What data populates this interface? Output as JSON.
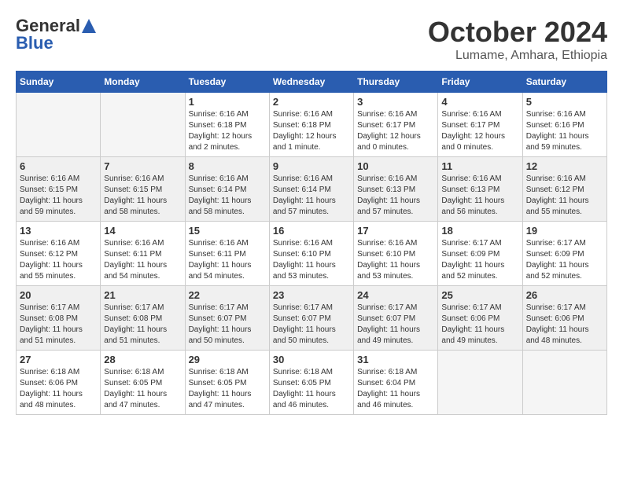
{
  "header": {
    "logo_line1": "General",
    "logo_line2": "Blue",
    "month_title": "October 2024",
    "location": "Lumame, Amhara, Ethiopia"
  },
  "weekdays": [
    "Sunday",
    "Monday",
    "Tuesday",
    "Wednesday",
    "Thursday",
    "Friday",
    "Saturday"
  ],
  "weeks": [
    [
      {
        "day": "",
        "sunrise": "",
        "sunset": "",
        "daylight": "",
        "empty": true
      },
      {
        "day": "",
        "sunrise": "",
        "sunset": "",
        "daylight": "",
        "empty": true
      },
      {
        "day": "1",
        "sunrise": "Sunrise: 6:16 AM",
        "sunset": "Sunset: 6:18 PM",
        "daylight": "Daylight: 12 hours and 2 minutes.",
        "empty": false
      },
      {
        "day": "2",
        "sunrise": "Sunrise: 6:16 AM",
        "sunset": "Sunset: 6:18 PM",
        "daylight": "Daylight: 12 hours and 1 minute.",
        "empty": false
      },
      {
        "day": "3",
        "sunrise": "Sunrise: 6:16 AM",
        "sunset": "Sunset: 6:17 PM",
        "daylight": "Daylight: 12 hours and 0 minutes.",
        "empty": false
      },
      {
        "day": "4",
        "sunrise": "Sunrise: 6:16 AM",
        "sunset": "Sunset: 6:17 PM",
        "daylight": "Daylight: 12 hours and 0 minutes.",
        "empty": false
      },
      {
        "day": "5",
        "sunrise": "Sunrise: 6:16 AM",
        "sunset": "Sunset: 6:16 PM",
        "daylight": "Daylight: 11 hours and 59 minutes.",
        "empty": false
      }
    ],
    [
      {
        "day": "6",
        "sunrise": "Sunrise: 6:16 AM",
        "sunset": "Sunset: 6:15 PM",
        "daylight": "Daylight: 11 hours and 59 minutes.",
        "empty": false
      },
      {
        "day": "7",
        "sunrise": "Sunrise: 6:16 AM",
        "sunset": "Sunset: 6:15 PM",
        "daylight": "Daylight: 11 hours and 58 minutes.",
        "empty": false
      },
      {
        "day": "8",
        "sunrise": "Sunrise: 6:16 AM",
        "sunset": "Sunset: 6:14 PM",
        "daylight": "Daylight: 11 hours and 58 minutes.",
        "empty": false
      },
      {
        "day": "9",
        "sunrise": "Sunrise: 6:16 AM",
        "sunset": "Sunset: 6:14 PM",
        "daylight": "Daylight: 11 hours and 57 minutes.",
        "empty": false
      },
      {
        "day": "10",
        "sunrise": "Sunrise: 6:16 AM",
        "sunset": "Sunset: 6:13 PM",
        "daylight": "Daylight: 11 hours and 57 minutes.",
        "empty": false
      },
      {
        "day": "11",
        "sunrise": "Sunrise: 6:16 AM",
        "sunset": "Sunset: 6:13 PM",
        "daylight": "Daylight: 11 hours and 56 minutes.",
        "empty": false
      },
      {
        "day": "12",
        "sunrise": "Sunrise: 6:16 AM",
        "sunset": "Sunset: 6:12 PM",
        "daylight": "Daylight: 11 hours and 55 minutes.",
        "empty": false
      }
    ],
    [
      {
        "day": "13",
        "sunrise": "Sunrise: 6:16 AM",
        "sunset": "Sunset: 6:12 PM",
        "daylight": "Daylight: 11 hours and 55 minutes.",
        "empty": false
      },
      {
        "day": "14",
        "sunrise": "Sunrise: 6:16 AM",
        "sunset": "Sunset: 6:11 PM",
        "daylight": "Daylight: 11 hours and 54 minutes.",
        "empty": false
      },
      {
        "day": "15",
        "sunrise": "Sunrise: 6:16 AM",
        "sunset": "Sunset: 6:11 PM",
        "daylight": "Daylight: 11 hours and 54 minutes.",
        "empty": false
      },
      {
        "day": "16",
        "sunrise": "Sunrise: 6:16 AM",
        "sunset": "Sunset: 6:10 PM",
        "daylight": "Daylight: 11 hours and 53 minutes.",
        "empty": false
      },
      {
        "day": "17",
        "sunrise": "Sunrise: 6:16 AM",
        "sunset": "Sunset: 6:10 PM",
        "daylight": "Daylight: 11 hours and 53 minutes.",
        "empty": false
      },
      {
        "day": "18",
        "sunrise": "Sunrise: 6:17 AM",
        "sunset": "Sunset: 6:09 PM",
        "daylight": "Daylight: 11 hours and 52 minutes.",
        "empty": false
      },
      {
        "day": "19",
        "sunrise": "Sunrise: 6:17 AM",
        "sunset": "Sunset: 6:09 PM",
        "daylight": "Daylight: 11 hours and 52 minutes.",
        "empty": false
      }
    ],
    [
      {
        "day": "20",
        "sunrise": "Sunrise: 6:17 AM",
        "sunset": "Sunset: 6:08 PM",
        "daylight": "Daylight: 11 hours and 51 minutes.",
        "empty": false
      },
      {
        "day": "21",
        "sunrise": "Sunrise: 6:17 AM",
        "sunset": "Sunset: 6:08 PM",
        "daylight": "Daylight: 11 hours and 51 minutes.",
        "empty": false
      },
      {
        "day": "22",
        "sunrise": "Sunrise: 6:17 AM",
        "sunset": "Sunset: 6:07 PM",
        "daylight": "Daylight: 11 hours and 50 minutes.",
        "empty": false
      },
      {
        "day": "23",
        "sunrise": "Sunrise: 6:17 AM",
        "sunset": "Sunset: 6:07 PM",
        "daylight": "Daylight: 11 hours and 50 minutes.",
        "empty": false
      },
      {
        "day": "24",
        "sunrise": "Sunrise: 6:17 AM",
        "sunset": "Sunset: 6:07 PM",
        "daylight": "Daylight: 11 hours and 49 minutes.",
        "empty": false
      },
      {
        "day": "25",
        "sunrise": "Sunrise: 6:17 AM",
        "sunset": "Sunset: 6:06 PM",
        "daylight": "Daylight: 11 hours and 49 minutes.",
        "empty": false
      },
      {
        "day": "26",
        "sunrise": "Sunrise: 6:17 AM",
        "sunset": "Sunset: 6:06 PM",
        "daylight": "Daylight: 11 hours and 48 minutes.",
        "empty": false
      }
    ],
    [
      {
        "day": "27",
        "sunrise": "Sunrise: 6:18 AM",
        "sunset": "Sunset: 6:06 PM",
        "daylight": "Daylight: 11 hours and 48 minutes.",
        "empty": false
      },
      {
        "day": "28",
        "sunrise": "Sunrise: 6:18 AM",
        "sunset": "Sunset: 6:05 PM",
        "daylight": "Daylight: 11 hours and 47 minutes.",
        "empty": false
      },
      {
        "day": "29",
        "sunrise": "Sunrise: 6:18 AM",
        "sunset": "Sunset: 6:05 PM",
        "daylight": "Daylight: 11 hours and 47 minutes.",
        "empty": false
      },
      {
        "day": "30",
        "sunrise": "Sunrise: 6:18 AM",
        "sunset": "Sunset: 6:05 PM",
        "daylight": "Daylight: 11 hours and 46 minutes.",
        "empty": false
      },
      {
        "day": "31",
        "sunrise": "Sunrise: 6:18 AM",
        "sunset": "Sunset: 6:04 PM",
        "daylight": "Daylight: 11 hours and 46 minutes.",
        "empty": false
      },
      {
        "day": "",
        "sunrise": "",
        "sunset": "",
        "daylight": "",
        "empty": true
      },
      {
        "day": "",
        "sunrise": "",
        "sunset": "",
        "daylight": "",
        "empty": true
      }
    ]
  ]
}
